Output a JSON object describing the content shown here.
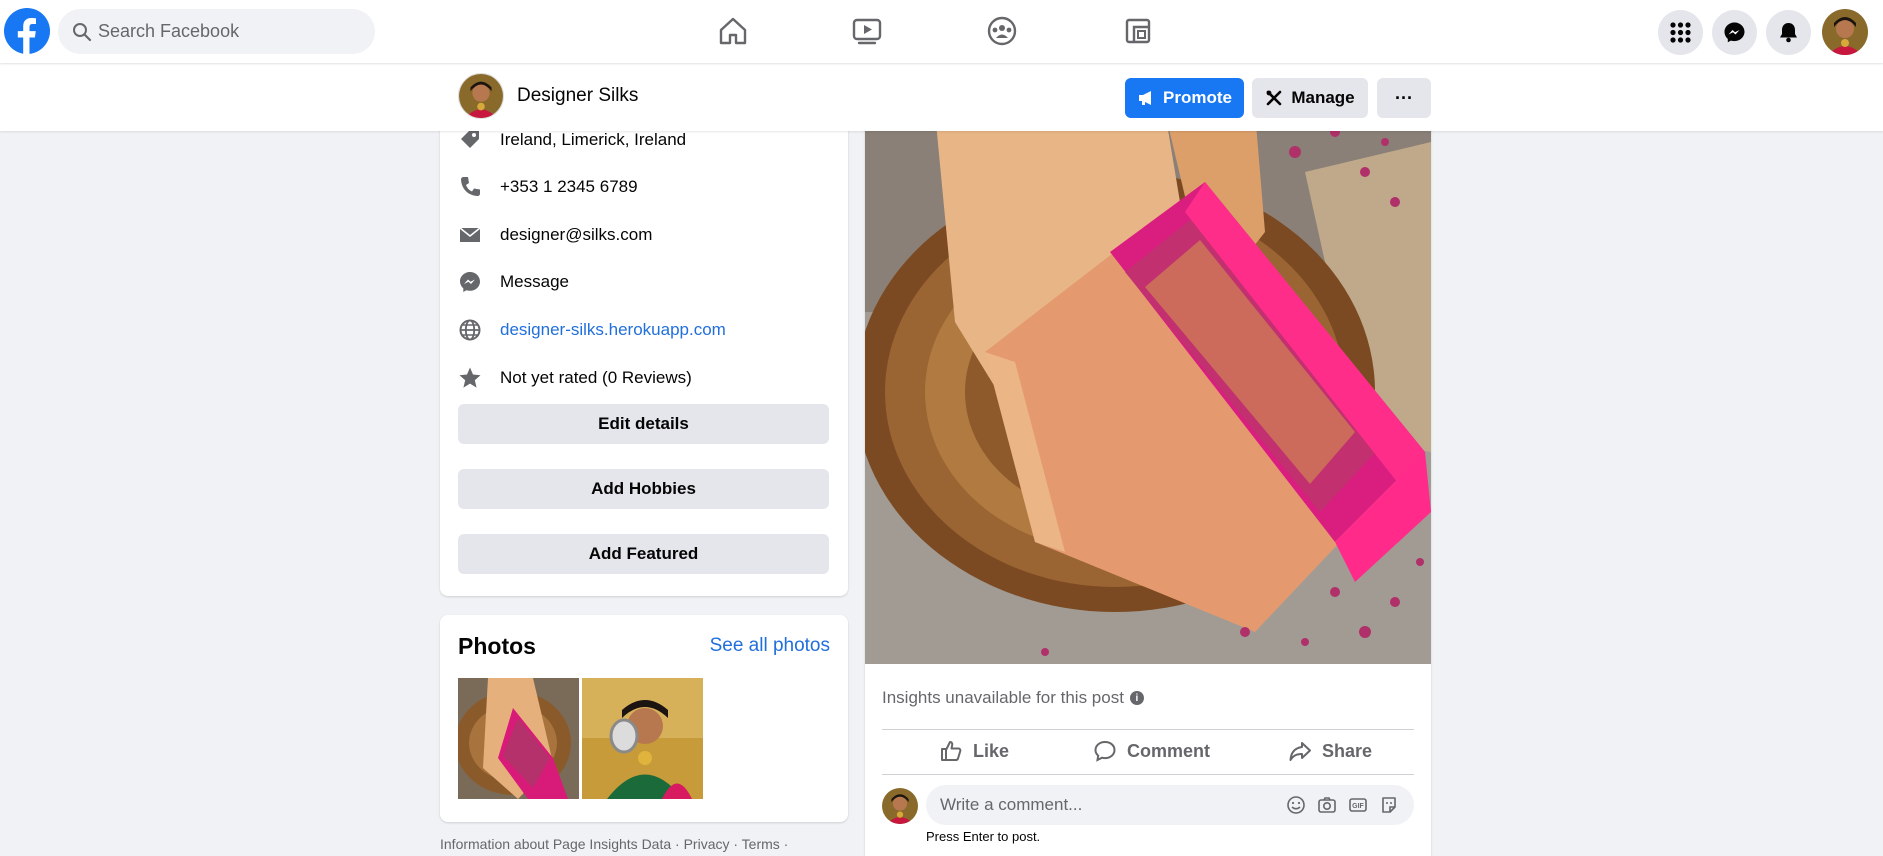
{
  "topbar": {
    "search_placeholder": "Search Facebook",
    "nav_icons": [
      "home-icon",
      "watch-icon",
      "groups-icon",
      "gaming-icon"
    ],
    "right_icons": [
      "menu-grid-icon",
      "messenger-icon",
      "notifications-icon"
    ]
  },
  "page": {
    "name": "Designer Silks",
    "promote_label": "Promote",
    "manage_label": "Manage",
    "more_label": "···"
  },
  "intro": {
    "location": "Ireland, Limerick, Ireland",
    "phone": "+353 1 2345 6789",
    "email": "designer@silks.com",
    "message": "Message",
    "website": "designer-silks.herokuapp.com",
    "rating": "Not yet rated (0 Reviews)",
    "edit_details": "Edit details",
    "add_hobbies": "Add Hobbies",
    "add_featured": "Add Featured"
  },
  "photos": {
    "title": "Photos",
    "see_all": "See all photos"
  },
  "footer": {
    "text": "Information about Page Insights Data · Privacy · Terms ·"
  },
  "post": {
    "insights": "Insights unavailable for this post",
    "like": "Like",
    "comment": "Comment",
    "share": "Share",
    "comment_placeholder": "Write a comment...",
    "press_enter": "Press Enter to post."
  },
  "colors": {
    "brand": "#1877f2",
    "link": "#216fdb",
    "background": "#f0f2f5"
  }
}
